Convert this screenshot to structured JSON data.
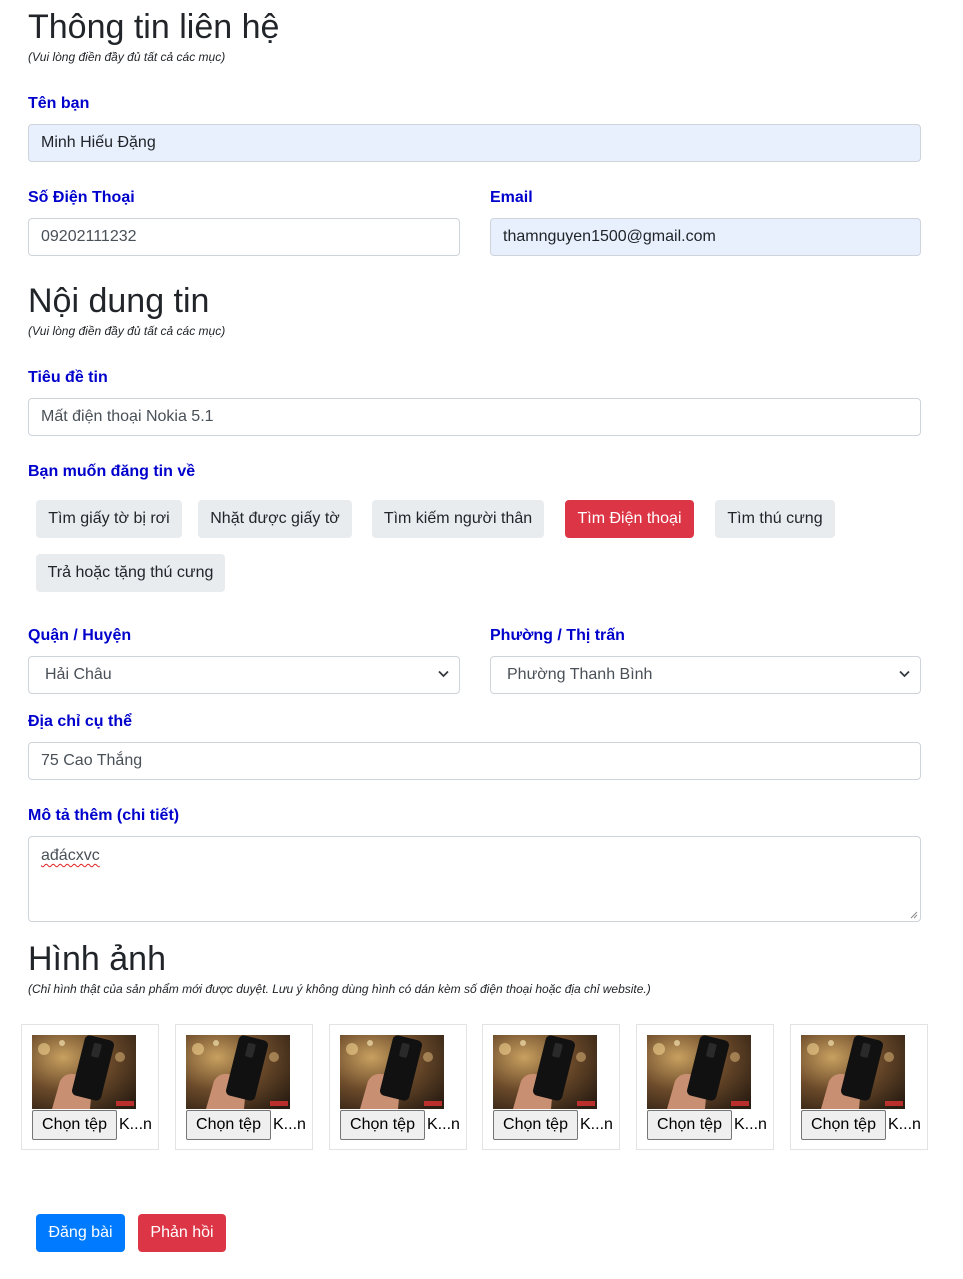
{
  "contact": {
    "title": "Thông tin liên hệ",
    "note": "(Vui lòng điền đầy đủ tất cả các mục)",
    "name_label": "Tên bạn",
    "name_value": "Minh Hiếu Đặng",
    "phone_label": "Số Điện Thoại",
    "phone_value": "09202111232",
    "email_label": "Email",
    "email_value": "thamnguyen1500@gmail.com"
  },
  "content": {
    "title": "Nội dung tin",
    "note": "(Vui lòng điền đầy đủ tất cả các mục)",
    "post_title_label": "Tiêu đề tin",
    "post_title_value": "Mất điện thoại Nokia 5.1",
    "category_label": "Bạn muốn đăng tin về",
    "categories": [
      "Tìm giấy tờ bị rơi",
      "Nhặt được giấy tờ",
      "Tìm kiếm người thân",
      "Tìm Điện thoại",
      "Tìm thú cưng",
      "Trả hoặc tặng thú cưng"
    ],
    "active_category": "Tìm Điện thoại",
    "district_label": "Quận / Huyện",
    "district_value": "Hải Châu",
    "ward_label": "Phường / Thị trấn",
    "ward_value": "Phường Thanh Bình",
    "address_label": "Địa chỉ cụ thể",
    "address_value": "75 Cao Thắng",
    "description_label": "Mô tả thêm (chi tiết)",
    "description_value": "ađácxvc"
  },
  "images": {
    "title": "Hình ảnh",
    "note": "(Chỉ hình thật của sản phẩm mới được duyệt. Lưu ý không dùng hình có dán kèm số điện thoại hoặc địa chỉ website.)",
    "choose_file_label": "Chọn tệp",
    "file_name_truncated": "K...n",
    "slot_count": 6
  },
  "actions": {
    "submit_label": "Đăng bài",
    "feedback_label": "Phản hồi"
  },
  "colors": {
    "label": "#0000cc",
    "active_chip": "#dc3545",
    "primary_button": "#007bff",
    "danger_button": "#dc3545",
    "autofill_bg": "#e8f0fe"
  }
}
